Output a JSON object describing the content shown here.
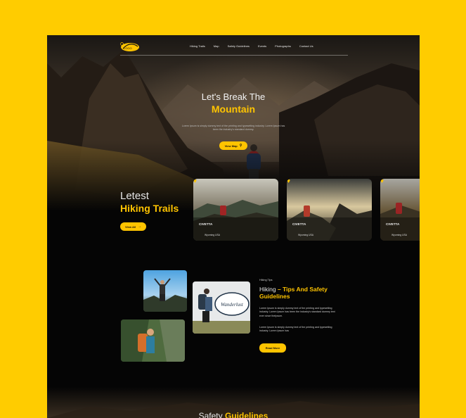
{
  "nav": {
    "logo_text": "LOGO",
    "links": [
      "Hiking Trails",
      "Map",
      "Safety Guidelines",
      "Events",
      "Photographs",
      "Contact Us"
    ]
  },
  "hero": {
    "title_line1": "Let's Break The",
    "title_line2": "Mountain",
    "description": "Lorem Ipsum is simply dummy text of the printing and typesetting industry. Lorem Ipsum has been the industry's standard dummy.",
    "button_label": "View Map"
  },
  "trails": {
    "title_line1": "Letest",
    "title_line2": "Hiking Trails",
    "view_all_label": "View All",
    "cards": [
      {
        "name": "CIVETTA",
        "location": "Wyoming USA"
      },
      {
        "name": "CIVETTA",
        "location": "Wyoming USA"
      },
      {
        "name": "CIVETTA",
        "location": "Wyoming USA"
      }
    ]
  },
  "tips": {
    "label": "Hiking Tips",
    "title_white": "Hiking",
    "title_yellow": "Tips And Safety Guidelines",
    "paragraph1": "Lorem Ipsum is simply dummy text of the printing and typesetting industry. Lorem Ipsum has been the industry's standard dummy text ever since theIpsum.",
    "paragraph2": "Lorem Ipsum is simply dummy text of the printing and typesetting industry. Lorem Ipsum has",
    "button_label": "Read More",
    "badge_text": "Wanderlust"
  },
  "safety": {
    "title_white": "Safety",
    "title_yellow": "Guidelines"
  },
  "colors": {
    "accent": "#FFC400",
    "background": "#FFCC00",
    "page": "#050505"
  }
}
